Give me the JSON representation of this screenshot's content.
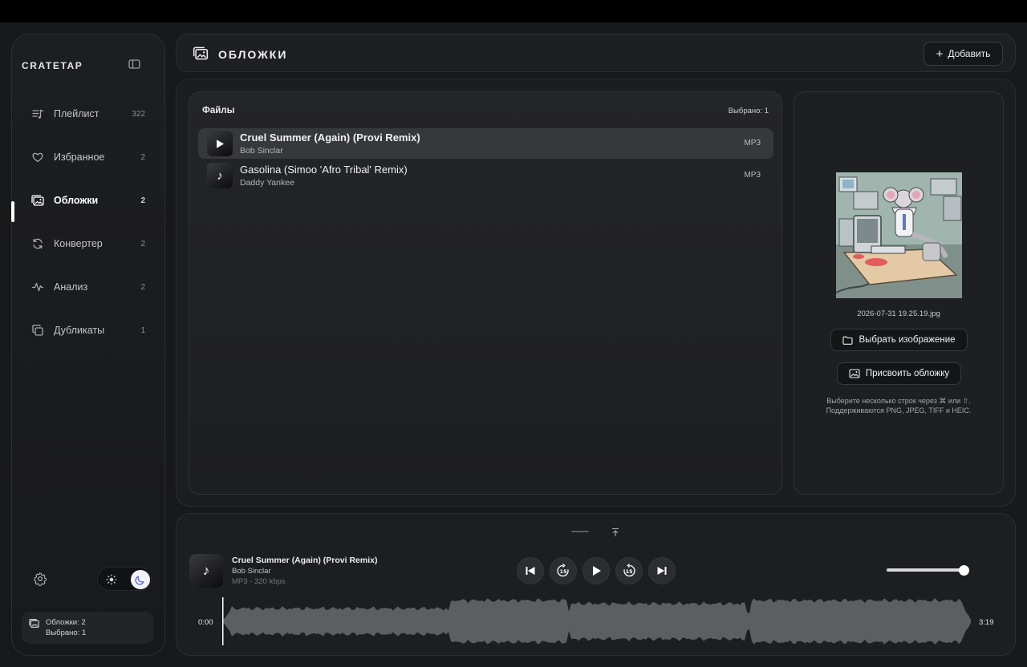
{
  "sidebar": {
    "brand": "CRATETAP",
    "items": [
      {
        "label": "Плейлист",
        "count": "322"
      },
      {
        "label": "Избранное",
        "count": "2"
      },
      {
        "label": "Обложки",
        "count": "2"
      },
      {
        "label": "Конвертер",
        "count": "2"
      },
      {
        "label": "Анализ",
        "count": "2"
      },
      {
        "label": "Дубликаты",
        "count": "1"
      }
    ],
    "active_index": 2,
    "theme": "dark",
    "status": {
      "line1": "Обложки: 2",
      "line2": "Выбрано: 1"
    }
  },
  "header": {
    "title": "ОБЛОЖКИ",
    "add_label": "Добавить"
  },
  "files": {
    "title": "Файлы",
    "selected_text": "Выбрано: 1",
    "rows": [
      {
        "title": "Cruel Summer (Again) (Provi Remix)",
        "artist": "Bob Sinclar",
        "format": "MP3",
        "selected": true
      },
      {
        "title": "Gasolina (Simoo 'Afro Tribal' Remix)",
        "artist": "Daddy Yankee",
        "format": "MP3",
        "selected": false
      }
    ]
  },
  "cover": {
    "filename": "2026-07-31 19.25.19.jpg",
    "choose_label": "Выбрать изображение",
    "assign_label": "Присвоить обложку",
    "hint_line1": "Выберите несколько строк через ⌘ или ⇧.",
    "hint_line2": "Поддерживаются PNG, JPEG, TIFF и HEIC."
  },
  "player": {
    "title": "Cruel Summer (Again) (Provi Remix)",
    "artist": "Bob Sinclar",
    "meta": "MP3 - 320 kbps",
    "skip_seconds": "15",
    "current_time": "0:00",
    "total_time": "3:19",
    "progress": 0.0,
    "volume": 0.92
  },
  "colors": {
    "background": "#18191b",
    "panel": "#1e1f22",
    "selected_row": "#37383c",
    "accent": "#ffffff",
    "moon_icon": "#5b6ee8",
    "waveform": "#5d5e62"
  }
}
